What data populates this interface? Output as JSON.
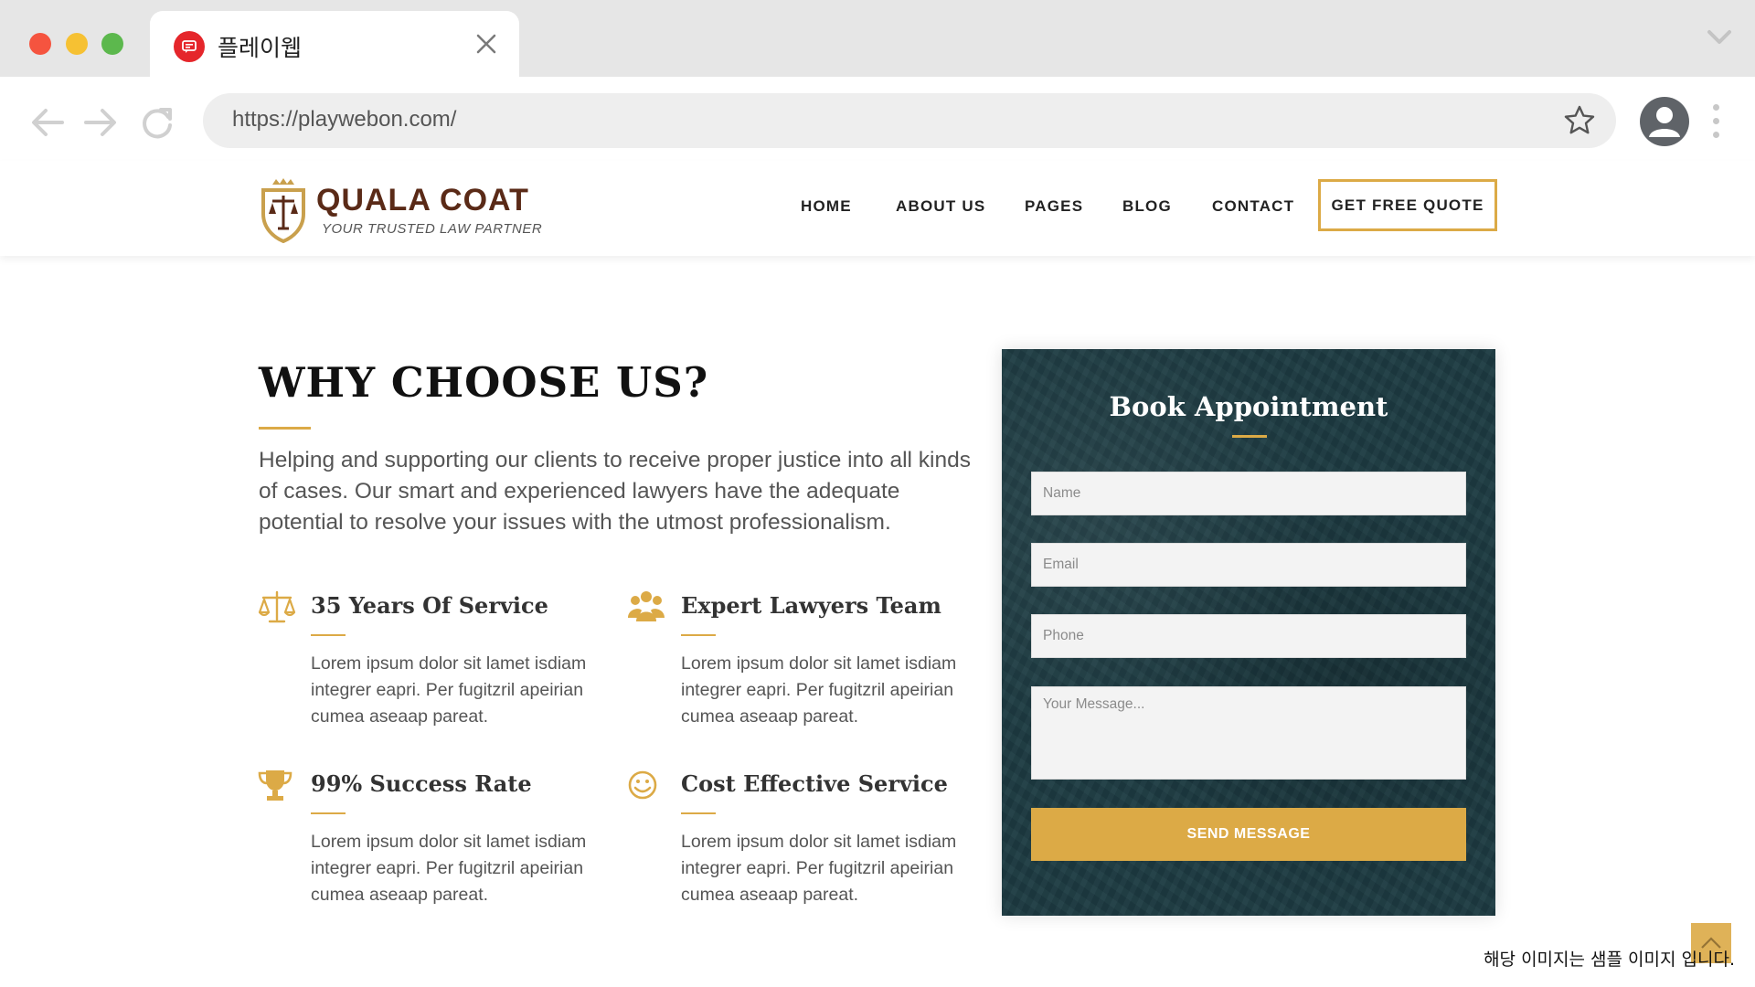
{
  "browser": {
    "tab_title": "플레이웹",
    "url": "https://playwebon.com/"
  },
  "site": {
    "logo_name": "QUALA COAT",
    "logo_tagline": "YOUR TRUSTED LAW PARTNER",
    "nav": [
      "HOME",
      "ABOUT US",
      "PAGES",
      "BLOG",
      "CONTACT"
    ],
    "cta_label": "GET FREE QUOTE"
  },
  "why": {
    "title": "WHY CHOOSE US?",
    "description": "Helping and supporting our clients to receive proper justice into all kinds of cases. Our smart and experienced lawyers have the adequate potential to resolve your issues with the utmost professionalism.",
    "features": [
      {
        "icon": "scales-icon",
        "title": "35 Years Of Service",
        "text": "Lorem ipsum dolor sit lamet isdiam integrer eapri. Per fugitzril apeirian cumea aseaap pareat."
      },
      {
        "icon": "team-icon",
        "title": "Expert Lawyers Team",
        "text": "Lorem ipsum dolor sit lamet isdiam integrer eapri. Per fugitzril apeirian cumea aseaap pareat."
      },
      {
        "icon": "trophy-icon",
        "title": "99% Success Rate",
        "text": "Lorem ipsum dolor sit lamet isdiam integrer eapri. Per fugitzril apeirian cumea aseaap pareat."
      },
      {
        "icon": "smiley-icon",
        "title": "Cost Effective Service",
        "text": "Lorem ipsum dolor sit lamet isdiam integrer eapri. Per fugitzril apeirian cumea aseaap pareat."
      }
    ]
  },
  "booking": {
    "title": "Book Appointment",
    "name_placeholder": "Name",
    "email_placeholder": "Email",
    "phone_placeholder": "Phone",
    "message_placeholder": "Your Message...",
    "submit_label": "SEND MESSAGE"
  },
  "footer_note": "해당 이미지는 샘플 이미지 입니다.",
  "colors": {
    "accent_gold": "#dcaa46",
    "logo_brown": "#5a2a17",
    "form_bg": "#1d3b42",
    "favicon_red": "#e5262b"
  }
}
